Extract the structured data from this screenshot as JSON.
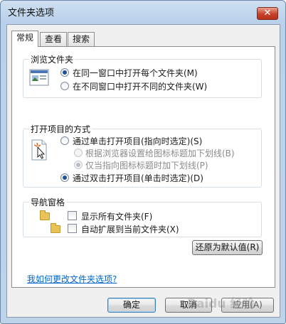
{
  "window": {
    "title": "文件夹选项",
    "close_label": "✕"
  },
  "tabs": [
    {
      "label": "常规",
      "active": true
    },
    {
      "label": "查看",
      "active": false
    },
    {
      "label": "搜索",
      "active": false
    }
  ],
  "browse_group": {
    "title": "浏览文件夹",
    "options": [
      {
        "label": "在同一窗口中打开每个文件夹(M)",
        "checked": true
      },
      {
        "label": "在不同窗口中打开不同的文件夹(W)",
        "checked": false
      }
    ]
  },
  "click_group": {
    "title": "打开项目的方式",
    "options": [
      {
        "label": "通过单击打开项目(指向时选定)(S)",
        "checked": false
      },
      {
        "label": "根据浏览器设置给图标标题加下划线(B)",
        "checked": false,
        "disabled": true
      },
      {
        "label": "仅当指向图标标题时加下划线(P)",
        "checked": true,
        "disabled": true
      },
      {
        "label": "通过双击打开项目(单击时选定)(D)",
        "checked": true
      }
    ]
  },
  "nav_group": {
    "title": "导航窗格",
    "options": [
      {
        "label": "显示所有文件夹(F)",
        "checked": false
      },
      {
        "label": "自动扩展到当前文件夹(X)",
        "checked": false
      }
    ]
  },
  "restore_button": "还原为默认值(R)",
  "help_link": "我如何更改文件夹选项?",
  "footer": {
    "ok": "确定",
    "cancel": "取消",
    "apply": "应用(A)"
  },
  "watermark": "Baidu 经验",
  "colors": {
    "accent": "#1f4f94",
    "link": "#0066cc",
    "close": "#c7432b"
  }
}
